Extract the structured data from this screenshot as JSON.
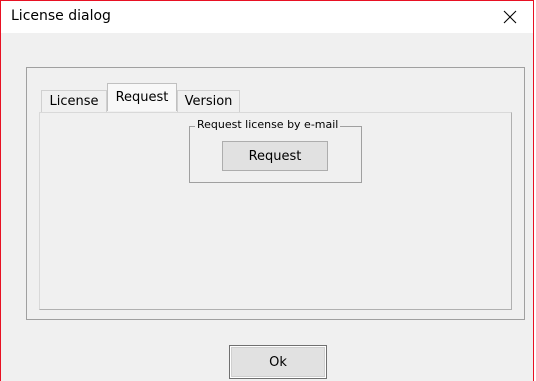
{
  "window": {
    "title": "License dialog"
  },
  "tabs": [
    {
      "label": "License",
      "active": false
    },
    {
      "label": "Request",
      "active": true
    },
    {
      "label": "Version",
      "active": false
    }
  ],
  "request_group": {
    "legend": "Request license by e-mail",
    "button_label": "Request"
  },
  "footer": {
    "ok_label": "Ok"
  },
  "icons": {
    "close": "close-icon"
  },
  "colors": {
    "window_border": "#e81123",
    "dialog_background": "#f0f0f0",
    "titlebar_background": "#ffffff"
  }
}
